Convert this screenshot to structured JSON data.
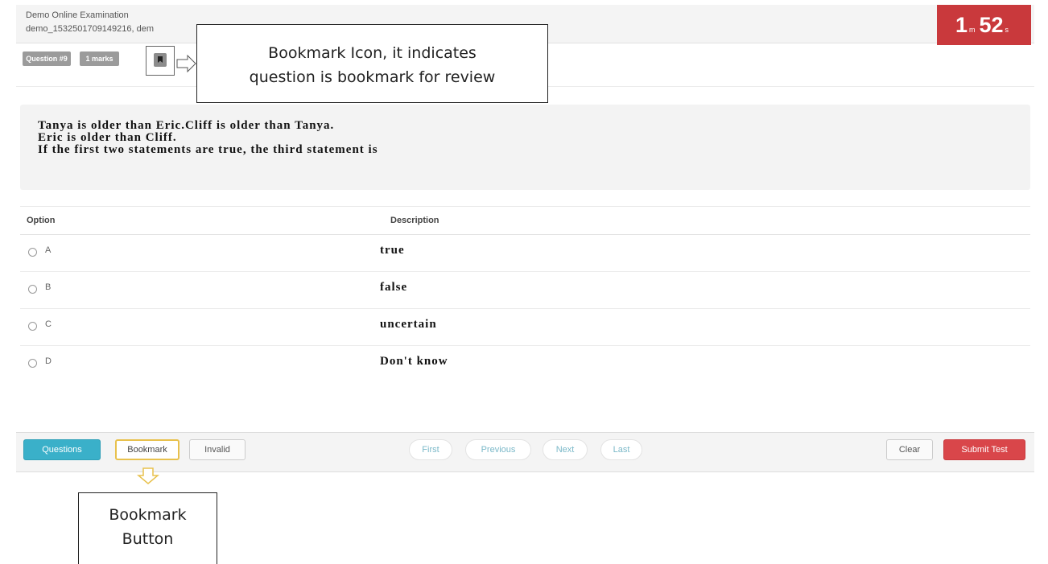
{
  "header": {
    "exam_title": "Demo Online Examination",
    "exam_user": "demo_1532501709149216, dem"
  },
  "timer": {
    "minutes": "1",
    "minutes_unit": "m",
    "seconds": "52",
    "seconds_unit": "s"
  },
  "question_meta": {
    "number_label": "Question #9",
    "marks_label": "1 marks",
    "bookmark_icon": "bookmark-icon"
  },
  "callouts": {
    "top_line1": "Bookmark Icon, it indicates",
    "top_line2": "question is bookmark for review",
    "bottom_line1": "Bookmark",
    "bottom_line2": "Button"
  },
  "question": {
    "lines": [
      "Tanya is older than Eric.Cliff is older than Tanya.",
      "Eric is older than Cliff.",
      "If the first two statements are true, the third statement is"
    ]
  },
  "options_table": {
    "headers": {
      "option": "Option",
      "description": "Description"
    },
    "rows": [
      {
        "letter": "A",
        "description": "true"
      },
      {
        "letter": "B",
        "description": "false"
      },
      {
        "letter": "C",
        "description": "uncertain"
      },
      {
        "letter": "D",
        "description": "Don't know"
      }
    ]
  },
  "toolbar": {
    "questions_label": "Questions",
    "bookmark_label": "Bookmark",
    "invalid_label": "Invalid",
    "first_label": "First",
    "previous_label": "Previous",
    "next_label": "Next",
    "last_label": "Last",
    "clear_label": "Clear",
    "submit_label": "Submit Test"
  },
  "colors": {
    "timer_bg": "#c9393c",
    "questions_btn": "#3ab0c9",
    "submit_btn": "#d9464a",
    "bookmark_highlight": "#e8c14d"
  }
}
